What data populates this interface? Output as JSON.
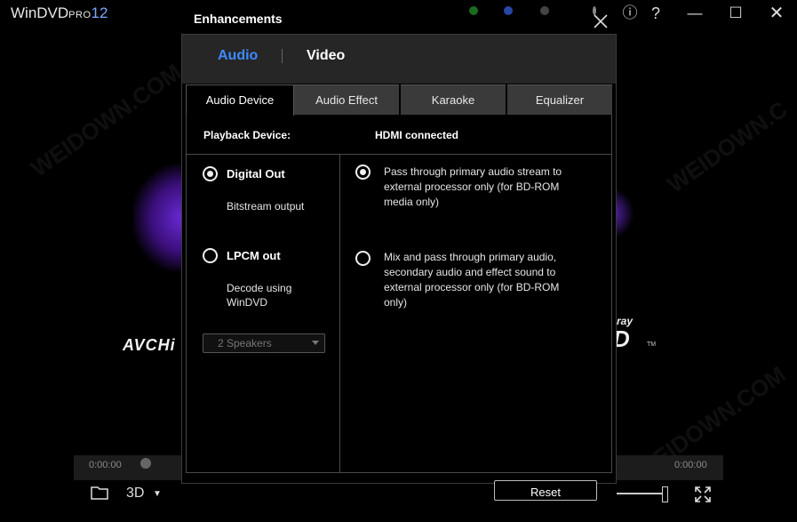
{
  "player": {
    "brand": "WinDVD",
    "edition": "PRO",
    "version": "12",
    "left_time": "0:00:00",
    "right_time": "0:00:00",
    "three_d_label": "3D",
    "logo_avchd": "AVCHi",
    "logo_bluray_top": "-ray",
    "logo_bluray_mark": "D",
    "logo_tm": "TM"
  },
  "window": {
    "info_glyph": "ⓘ",
    "help_glyph": "?",
    "min_glyph": "—",
    "max_glyph": "☐",
    "close_glyph": "✕"
  },
  "dialog": {
    "title": "Enhancements",
    "top_tabs": [
      "Audio",
      "Video"
    ],
    "tabs": [
      "Audio Device",
      "Audio Effect",
      "Karaoke",
      "Equalizer"
    ],
    "playback_label": "Playback Device:",
    "playback_value": "HDMI connected",
    "left_options": [
      {
        "label": "Digital Out",
        "desc": "Bitstream output",
        "selected": true
      },
      {
        "label": "LPCM out",
        "desc_line1": "Decode using",
        "desc_line2": "WinDVD",
        "selected": false
      }
    ],
    "speakers": "2 Speakers",
    "right_options": [
      {
        "line1": "Pass through primary audio stream to",
        "line2": "external processor only (for BD-ROM",
        "line3": "media only)",
        "selected": true
      },
      {
        "line1": "Mix and pass through primary audio,",
        "line2": "secondary audio and effect sound to",
        "line3": "external processor only (for BD-ROM",
        "line4": "only)",
        "selected": false
      }
    ],
    "reset_label": "Reset"
  },
  "colors": {
    "accent": "#3d8aff",
    "tab_bg": "#3a3a3a",
    "topbar_bg": "#262626"
  }
}
